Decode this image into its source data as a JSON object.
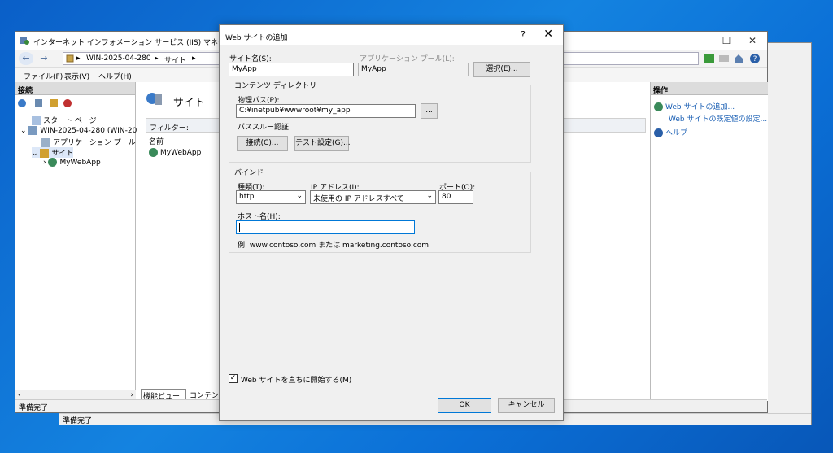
{
  "back_window": {
    "status": "準備完了"
  },
  "main_window": {
    "title": "インターネット インフォメーション サービス (IIS) マネージャー",
    "breadcrumb": [
      "WIN-2025-04-280",
      "サイト"
    ],
    "menu": [
      "ファイル(F)",
      "表示(V)",
      "ヘルプ(H)"
    ],
    "connections": {
      "header": "接続",
      "tree": [
        "スタート ページ",
        "WIN-2025-04-280 (WIN-2025-",
        "アプリケーション プール",
        "サイト",
        "MyWebApp"
      ]
    },
    "center": {
      "title": "サイト",
      "filter_label": "フィルター:",
      "column_name": "名前",
      "rows": [
        "MyWebApp"
      ],
      "tab_features": "機能ビュー",
      "tab_content": "コンテン"
    },
    "actions": {
      "header": "操作",
      "items": [
        "Web サイトの追加...",
        "Web サイトの既定値の設定...",
        "ヘルプ"
      ]
    },
    "status": "準備完了"
  },
  "dialog": {
    "title": "Web サイトの追加",
    "help_glyph": "?",
    "close_glyph": "✕",
    "site_name_label": "サイト名(S):",
    "site_name_value": "MyApp",
    "app_pool_label": "アプリケーション プール(L):",
    "app_pool_value": "MyApp",
    "select_button": "選択(E)...",
    "content_dir_label": "コンテンツ ディレクトリ",
    "physical_path_label": "物理パス(P):",
    "physical_path_value": "C:¥inetpub¥wwwroot¥my_app",
    "browse_button": "...",
    "passthrough_label": "パススルー認証",
    "connect_button": "接続(C)...",
    "test_button": "テスト設定(G)...",
    "binding_label": "バインド",
    "type_label": "種類(T):",
    "type_value": "http",
    "ip_label": "IP アドレス(I):",
    "ip_value": "未使用の IP アドレスすべて",
    "port_label": "ポート(O):",
    "port_value": "80",
    "host_label": "ホスト名(H):",
    "host_value": "",
    "example_text": "例: www.contoso.com または marketing.contoso.com",
    "start_checkbox_label": "Web サイトを直ちに開始する(M)",
    "start_checked": true,
    "ok_button": "OK",
    "cancel_button": "キャンセル"
  }
}
